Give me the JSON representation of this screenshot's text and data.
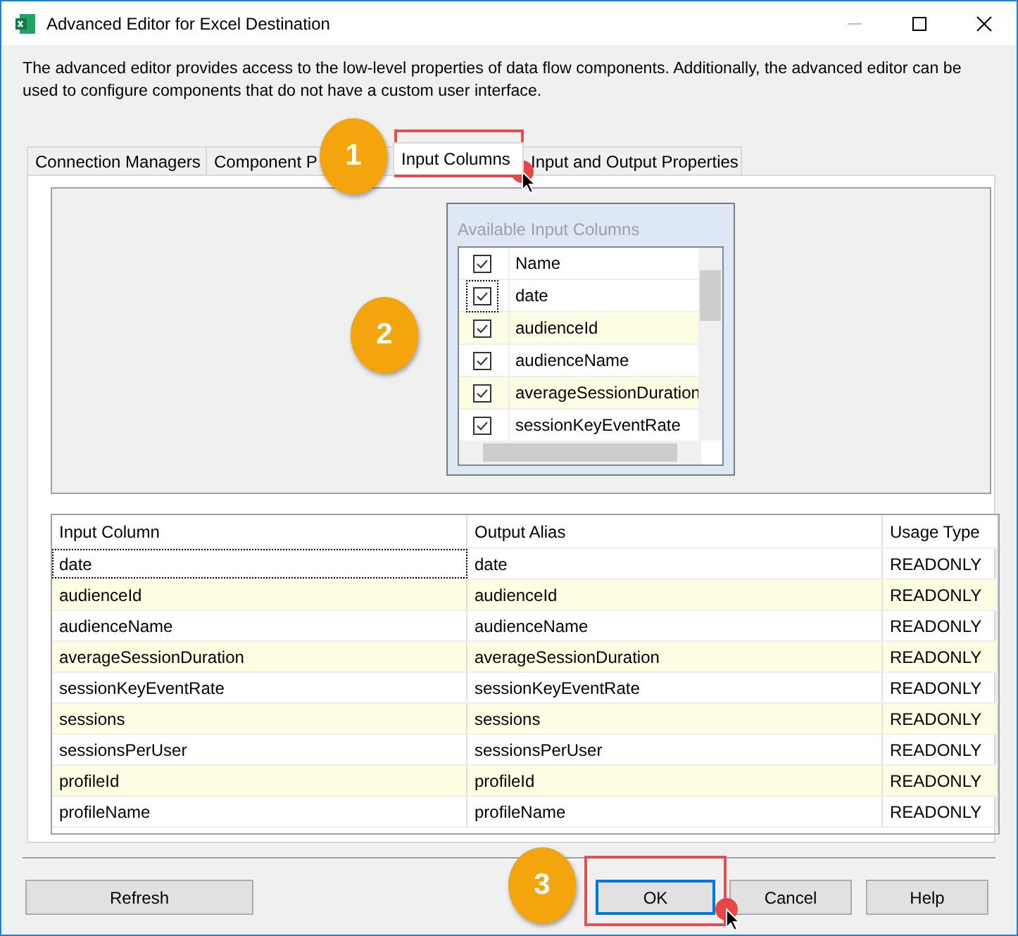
{
  "window": {
    "title": "Advanced Editor for Excel Destination"
  },
  "description": "The advanced editor provides access to the low-level properties of data flow components. Additionally, the advanced editor can be used to configure components that do not have a custom user interface.",
  "tabs": [
    {
      "label": "Connection Managers",
      "selected": false
    },
    {
      "label": "Component P",
      "selected": false
    },
    {
      "label": "Input Columns",
      "selected": true
    },
    {
      "label": "Input and Output Properties",
      "selected": false
    }
  ],
  "available_columns": {
    "title": "Available Input Columns",
    "header": {
      "label": "Name",
      "checked": true
    },
    "items": [
      {
        "label": "date",
        "checked": true
      },
      {
        "label": "audienceId",
        "checked": true
      },
      {
        "label": "audienceName",
        "checked": true
      },
      {
        "label": "averageSessionDuration",
        "checked": true
      },
      {
        "label": "sessionKeyEventRate",
        "checked": true
      }
    ]
  },
  "grid": {
    "columns": [
      "Input Column",
      "Output Alias",
      "Usage Type"
    ],
    "rows": [
      [
        "date",
        "date",
        "READONLY"
      ],
      [
        "audienceId",
        "audienceId",
        "READONLY"
      ],
      [
        "audienceName",
        "audienceName",
        "READONLY"
      ],
      [
        "averageSessionDuration",
        "averageSessionDuration",
        "READONLY"
      ],
      [
        "sessionKeyEventRate",
        "sessionKeyEventRate",
        "READONLY"
      ],
      [
        "sessions",
        "sessions",
        "READONLY"
      ],
      [
        "sessionsPerUser",
        "sessionsPerUser",
        "READONLY"
      ],
      [
        "profileId",
        "profileId",
        "READONLY"
      ],
      [
        "profileName",
        "profileName",
        "READONLY"
      ]
    ]
  },
  "buttons": [
    {
      "label": "Refresh",
      "kind": "left"
    },
    {
      "label": "OK",
      "kind": "default"
    },
    {
      "label": "Cancel",
      "kind": "normal"
    },
    {
      "label": "Help",
      "kind": "normal"
    }
  ],
  "annotations": [
    "1",
    "2",
    "3"
  ]
}
